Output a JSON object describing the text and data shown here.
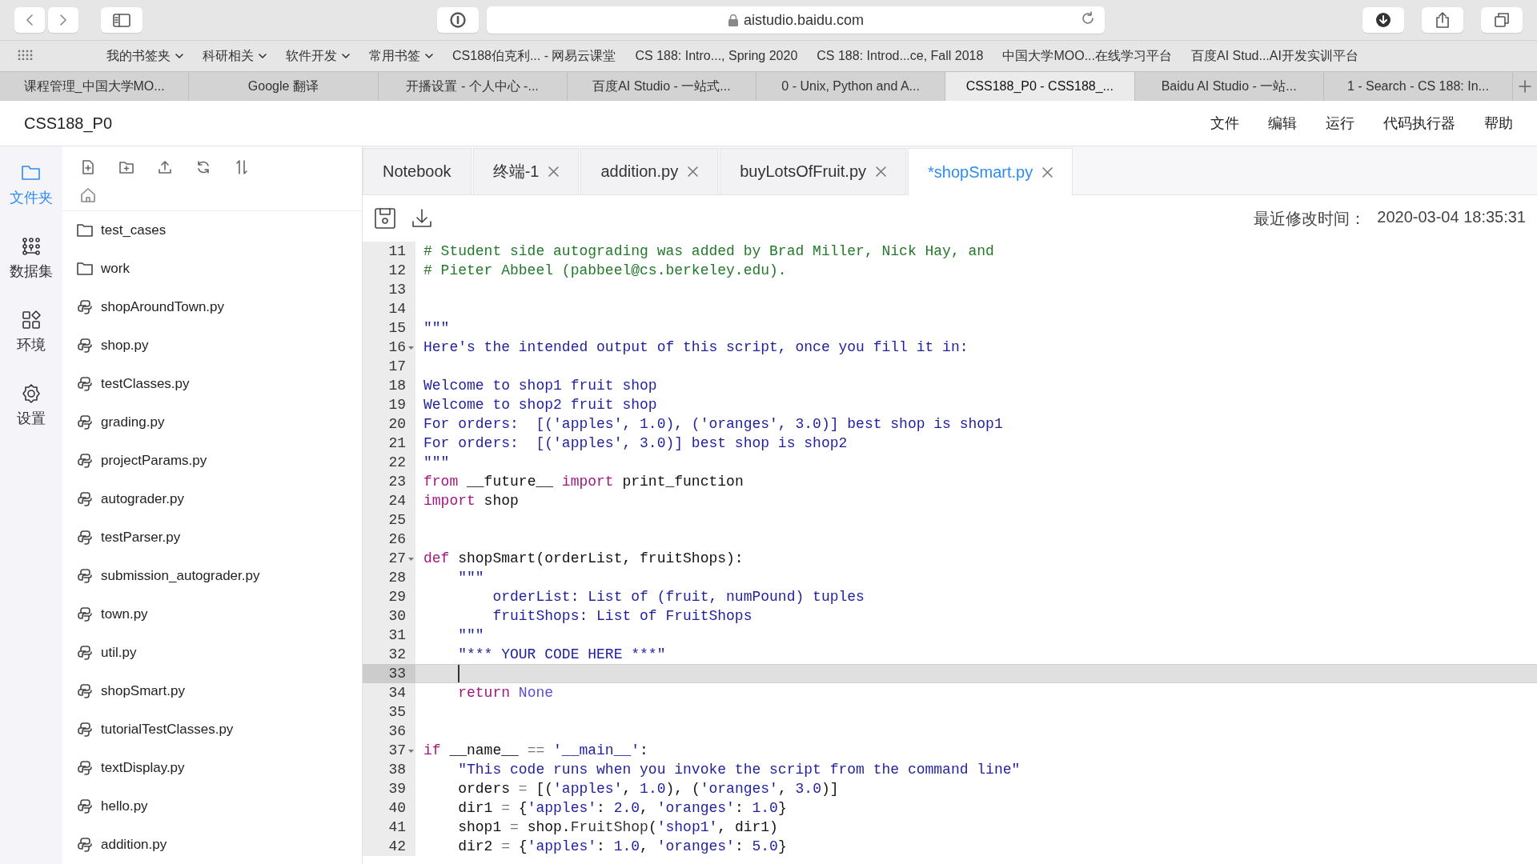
{
  "browser": {
    "address": "aistudio.baidu.com",
    "bookmarks": [
      {
        "label": "我的书签夹",
        "folder": true
      },
      {
        "label": "科研相关",
        "folder": true
      },
      {
        "label": "软件开发",
        "folder": true
      },
      {
        "label": "常用书签",
        "folder": true
      },
      {
        "label": "CS188伯克利... - 网易云课堂",
        "folder": false
      },
      {
        "label": "CS 188: Intro..., Spring 2020",
        "folder": false
      },
      {
        "label": "CS 188: Introd...ce, Fall 2018",
        "folder": false
      },
      {
        "label": "中国大学MOO...在线学习平台",
        "folder": false
      },
      {
        "label": "百度AI Stud...AI开发实训平台",
        "folder": false
      }
    ],
    "tabs": [
      {
        "label": "课程管理_中国大学MO...",
        "selected": false
      },
      {
        "label": "Google 翻译",
        "selected": false
      },
      {
        "label": "开播设置 - 个人中心 -...",
        "selected": false
      },
      {
        "label": "百度AI Studio - 一站式...",
        "selected": false
      },
      {
        "label": "0 - Unix, Python and A...",
        "selected": false
      },
      {
        "label": "CSS188_P0 - CSS188_...",
        "selected": true
      },
      {
        "label": "Baidu AI Studio - 一站...",
        "selected": false
      },
      {
        "label": "1 - Search - CS 188: In...",
        "selected": false
      }
    ]
  },
  "app": {
    "title": "CSS188_P0",
    "menu": [
      "文件",
      "编辑",
      "运行",
      "代码执行器",
      "帮助"
    ]
  },
  "rail": [
    {
      "label": "文件夹",
      "kind": "folder",
      "selected": true
    },
    {
      "label": "数据集",
      "kind": "dataset",
      "selected": false
    },
    {
      "label": "环境",
      "kind": "env",
      "selected": false
    },
    {
      "label": "设置",
      "kind": "settings",
      "selected": false
    }
  ],
  "files": [
    {
      "name": "test_cases",
      "kind": "folder"
    },
    {
      "name": "work",
      "kind": "folder"
    },
    {
      "name": "shopAroundTown.py",
      "kind": "python"
    },
    {
      "name": "shop.py",
      "kind": "python"
    },
    {
      "name": "testClasses.py",
      "kind": "python"
    },
    {
      "name": "grading.py",
      "kind": "python"
    },
    {
      "name": "projectParams.py",
      "kind": "python"
    },
    {
      "name": "autograder.py",
      "kind": "python"
    },
    {
      "name": "testParser.py",
      "kind": "python"
    },
    {
      "name": "submission_autograder.py",
      "kind": "python"
    },
    {
      "name": "town.py",
      "kind": "python"
    },
    {
      "name": "util.py",
      "kind": "python"
    },
    {
      "name": "shopSmart.py",
      "kind": "python"
    },
    {
      "name": "tutorialTestClasses.py",
      "kind": "python"
    },
    {
      "name": "textDisplay.py",
      "kind": "python"
    },
    {
      "name": "hello.py",
      "kind": "python"
    },
    {
      "name": "addition.py",
      "kind": "python"
    }
  ],
  "editor": {
    "tabs": [
      {
        "label": "Notebook",
        "closable": false,
        "selected": false
      },
      {
        "label": "终端-1",
        "closable": true,
        "selected": false
      },
      {
        "label": "addition.py",
        "closable": true,
        "selected": false
      },
      {
        "label": "buyLotsOfFruit.py",
        "closable": true,
        "selected": false
      },
      {
        "label": "*shopSmart.py",
        "closable": true,
        "selected": true
      }
    ],
    "modified_label": "最近修改时间：",
    "modified_value": "2020-03-04 18:35:31",
    "lines": [
      {
        "num": "11",
        "fold": false,
        "current": false,
        "tokens": [
          {
            "kind": "comment",
            "text": "# Student side autograding was added by Brad Miller, Nick Hay, and"
          }
        ]
      },
      {
        "num": "12",
        "fold": false,
        "current": false,
        "tokens": [
          {
            "kind": "comment",
            "text": "# Pieter Abbeel (pabbeel@cs.berkeley.edu)."
          }
        ]
      },
      {
        "num": "13",
        "fold": false,
        "current": false
      },
      {
        "num": "14",
        "fold": false,
        "current": false
      },
      {
        "num": "15",
        "fold": false,
        "current": false,
        "tokens": [
          {
            "kind": "string",
            "text": "\"\"\""
          }
        ]
      },
      {
        "num": "16",
        "fold": true,
        "current": false,
        "tokens": [
          {
            "kind": "string",
            "text": "Here's the intended output of this script, once you fill it in:"
          }
        ]
      },
      {
        "num": "17",
        "fold": false,
        "current": false
      },
      {
        "num": "18",
        "fold": false,
        "current": false,
        "tokens": [
          {
            "kind": "string",
            "text": "Welcome to shop1 fruit shop"
          }
        ]
      },
      {
        "num": "19",
        "fold": false,
        "current": false,
        "tokens": [
          {
            "kind": "string",
            "text": "Welcome to shop2 fruit shop"
          }
        ]
      },
      {
        "num": "20",
        "fold": false,
        "current": false,
        "tokens": [
          {
            "kind": "string",
            "text": "For orders:  [('apples', 1.0), ('oranges', 3.0)] best shop is shop1"
          }
        ]
      },
      {
        "num": "21",
        "fold": false,
        "current": false,
        "tokens": [
          {
            "kind": "string",
            "text": "For orders:  [('apples', 3.0)] best shop is shop2"
          }
        ]
      },
      {
        "num": "22",
        "fold": false,
        "current": false,
        "tokens": [
          {
            "kind": "string",
            "text": "\"\"\""
          }
        ]
      },
      {
        "num": "23",
        "fold": false,
        "current": false,
        "tokens": [
          {
            "kind": "keyword",
            "text": "from"
          },
          {
            "kind": "plain",
            "text": " __future__ "
          },
          {
            "kind": "keyword",
            "text": "import"
          },
          {
            "kind": "plain",
            "text": " print_function"
          }
        ]
      },
      {
        "num": "24",
        "fold": false,
        "current": false,
        "tokens": [
          {
            "kind": "keyword",
            "text": "import"
          },
          {
            "kind": "plain",
            "text": " shop"
          }
        ]
      },
      {
        "num": "25",
        "fold": false,
        "current": false
      },
      {
        "num": "26",
        "fold": false,
        "current": false
      },
      {
        "num": "27",
        "fold": true,
        "current": false,
        "tokens": [
          {
            "kind": "keyword",
            "text": "def"
          },
          {
            "kind": "plain",
            "text": " shopSmart(orderList, fruitShops):"
          }
        ]
      },
      {
        "num": "28",
        "fold": false,
        "current": false,
        "tokens": [
          {
            "kind": "string",
            "text": "    \"\"\""
          }
        ]
      },
      {
        "num": "29",
        "fold": false,
        "current": false,
        "tokens": [
          {
            "kind": "string",
            "text": "        orderList: List of (fruit, numPound) tuples"
          }
        ]
      },
      {
        "num": "30",
        "fold": false,
        "current": false,
        "tokens": [
          {
            "kind": "string",
            "text": "        fruitShops: List of FruitShops"
          }
        ]
      },
      {
        "num": "31",
        "fold": false,
        "current": false,
        "tokens": [
          {
            "kind": "string",
            "text": "    \"\"\""
          }
        ]
      },
      {
        "num": "32",
        "fold": false,
        "current": false,
        "tokens": [
          {
            "kind": "string",
            "text": "    \"*** YOUR CODE HERE ***\""
          }
        ]
      },
      {
        "num": "33",
        "fold": false,
        "current": true
      },
      {
        "num": "34",
        "fold": false,
        "current": false,
        "tokens": [
          {
            "kind": "keyword",
            "text": "    return "
          },
          {
            "kind": "constant",
            "text": "None"
          }
        ]
      },
      {
        "num": "35",
        "fold": false,
        "current": false
      },
      {
        "num": "36",
        "fold": false,
        "current": false
      },
      {
        "num": "37",
        "fold": true,
        "current": false,
        "tokens": [
          {
            "kind": "keyword",
            "text": "if"
          },
          {
            "kind": "plain",
            "text": " __name__ "
          },
          {
            "kind": "operator",
            "text": "=="
          },
          {
            "kind": "string",
            "text": " '__main__'"
          },
          {
            "kind": "plain",
            "text": ":"
          }
        ]
      },
      {
        "num": "38",
        "fold": false,
        "current": false,
        "tokens": [
          {
            "kind": "string",
            "text": "    \"This code runs when you invoke the script from the command line\""
          }
        ]
      },
      {
        "num": "39",
        "fold": false,
        "current": false,
        "tokens": [
          {
            "kind": "plain",
            "text": "    orders "
          },
          {
            "kind": "operator",
            "text": "="
          },
          {
            "kind": "plain",
            "text": " [("
          },
          {
            "kind": "string",
            "text": "'apples'"
          },
          {
            "kind": "plain",
            "text": ", "
          },
          {
            "kind": "string",
            "text": "1.0"
          },
          {
            "kind": "plain",
            "text": "), ("
          },
          {
            "kind": "string",
            "text": "'oranges'"
          },
          {
            "kind": "plain",
            "text": ", "
          },
          {
            "kind": "string",
            "text": "3.0"
          },
          {
            "kind": "plain",
            "text": ")]"
          }
        ]
      },
      {
        "num": "40",
        "fold": false,
        "current": false,
        "tokens": [
          {
            "kind": "plain",
            "text": "    dir1 "
          },
          {
            "kind": "operator",
            "text": "="
          },
          {
            "kind": "plain",
            "text": " {"
          },
          {
            "kind": "string",
            "text": "'apples'"
          },
          {
            "kind": "plain",
            "text": ": "
          },
          {
            "kind": "string",
            "text": "2.0"
          },
          {
            "kind": "plain",
            "text": ", "
          },
          {
            "kind": "string",
            "text": "'oranges'"
          },
          {
            "kind": "plain",
            "text": ": "
          },
          {
            "kind": "string",
            "text": "1.0"
          },
          {
            "kind": "plain",
            "text": "}"
          }
        ]
      },
      {
        "num": "41",
        "fold": false,
        "current": false,
        "tokens": [
          {
            "kind": "plain",
            "text": "    shop1 "
          },
          {
            "kind": "operator",
            "text": "="
          },
          {
            "kind": "plain",
            "text": " shop."
          },
          {
            "kind": "attr",
            "text": "FruitShop"
          },
          {
            "kind": "plain",
            "text": "("
          },
          {
            "kind": "string",
            "text": "'shop1'"
          },
          {
            "kind": "plain",
            "text": ", dir1)"
          }
        ]
      },
      {
        "num": "42",
        "fold": false,
        "current": false,
        "tokens": [
          {
            "kind": "plain",
            "text": "    dir2 "
          },
          {
            "kind": "operator",
            "text": "="
          },
          {
            "kind": "plain",
            "text": " {"
          },
          {
            "kind": "string",
            "text": "'apples'"
          },
          {
            "kind": "plain",
            "text": ": "
          },
          {
            "kind": "string",
            "text": "1.0"
          },
          {
            "kind": "plain",
            "text": ", "
          },
          {
            "kind": "string",
            "text": "'oranges'"
          },
          {
            "kind": "plain",
            "text": ": "
          },
          {
            "kind": "string",
            "text": "5.0"
          },
          {
            "kind": "plain",
            "text": "}"
          }
        ]
      }
    ]
  }
}
